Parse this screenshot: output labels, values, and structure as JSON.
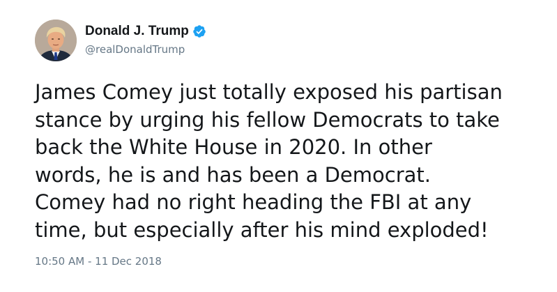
{
  "author": {
    "display_name": "Donald J. Trump",
    "handle": "@realDonaldTrump",
    "verified": true,
    "verified_icon": "verified-badge-icon",
    "verified_color": "#1da1f2",
    "avatar": "profile-photo"
  },
  "tweet": {
    "lines": [
      "James Comey just totally exposed his partisan",
      "stance by urging his fellow Democrats to take",
      "back the White House in 2020. In other",
      "words, he is and has been a Democrat.",
      "Comey had no right heading the FBI at any",
      "time, but especially after his mind exploded!"
    ],
    "timestamp": "10:50 AM - 11 Dec 2018"
  },
  "colors": {
    "text_primary": "#14171a",
    "text_secondary": "#657786",
    "background": "#ffffff"
  }
}
